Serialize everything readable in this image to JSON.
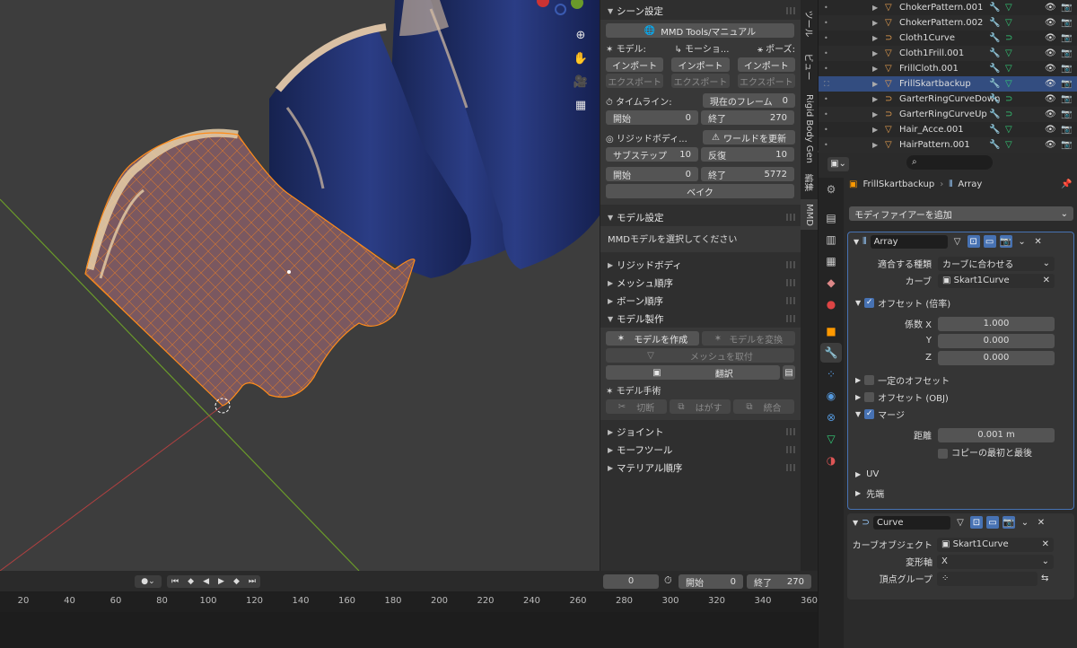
{
  "viewport": {
    "nav": {
      "zoom": "zoom-icon",
      "hand": "hand-icon",
      "camera": "camera-icon",
      "grid": "grid-icon"
    }
  },
  "npanel": {
    "scene": {
      "title": "シーン設定",
      "manual_button": "MMD Tools/マニュアル",
      "model_label": "モデル:",
      "motion_label": "モーショ...",
      "pose_label": "ポーズ:",
      "import": "インポート",
      "export": "エクスポート",
      "timeline_label": "タイムライン:",
      "current_frame_label": "現在のフレーム",
      "current_frame": "0",
      "start_label": "開始",
      "start": "0",
      "end_label": "終了",
      "end": "270",
      "rigidbody_label": "リジッドボディ...",
      "update_world": "ワールドを更新",
      "substep_label": "サブステップ",
      "substep": "10",
      "iter_label": "反復",
      "iter": "10",
      "rb_start": "0",
      "rb_end": "5772",
      "bake": "ベイク"
    },
    "model": {
      "title": "モデル設定",
      "hint": "MMDモデルを選択してください"
    },
    "sections": [
      "リジッドボディ",
      "メッシュ順序",
      "ボーン順序"
    ],
    "model_make": {
      "title": "モデル製作",
      "create": "モデルを作成",
      "convert": "モデルを変換",
      "attach": "メッシュを取付",
      "translate": "翻訳",
      "surgery": "モデル手術",
      "cut": "切断",
      "separate": "はがす",
      "merge": "統合"
    },
    "sections2": [
      "ジョイント",
      "モーフツール",
      "マテリアル順序"
    ]
  },
  "vtabs": [
    "ツール",
    "ビュー",
    "Rigid Body Gen",
    "編集",
    "MMD"
  ],
  "timeline": {
    "frame": "0",
    "start_label": "開始",
    "start": "0",
    "end_label": "終了",
    "end": "270",
    "ticks": [
      "20",
      "40",
      "60",
      "80",
      "100",
      "120",
      "140",
      "160",
      "180",
      "200",
      "220",
      "240",
      "260",
      "280",
      "300",
      "320",
      "340",
      "360"
    ]
  },
  "outliner": {
    "items": [
      {
        "name": "ChokerPattern.001",
        "type": "mesh"
      },
      {
        "name": "ChokerPattern.002",
        "type": "mesh"
      },
      {
        "name": "Cloth1Curve",
        "type": "curve"
      },
      {
        "name": "Cloth1Frill.001",
        "type": "mesh"
      },
      {
        "name": "FrillCloth.001",
        "type": "mesh"
      },
      {
        "name": "FrillSkartbackup",
        "type": "mesh",
        "selected": true
      },
      {
        "name": "GarterRingCurveDown",
        "type": "curve"
      },
      {
        "name": "GarterRingCurveUp",
        "type": "curve"
      },
      {
        "name": "Hair_Acce.001",
        "type": "mesh"
      },
      {
        "name": "HairPattern.001",
        "type": "mesh"
      }
    ]
  },
  "props": {
    "search_placeholder": "",
    "object": "FrillSkartbackup",
    "modifier_name": "Array",
    "add_modifier": "モディファイアーを追加",
    "array": {
      "name": "Array",
      "fit_type_label": "適合する種類",
      "fit_type": "カーブに合わせる",
      "curve_label": "カーブ",
      "curve": "Skart1Curve",
      "relative_offset": "オフセット (倍率)",
      "factor_x_label": "係数 X",
      "factor_x": "1.000",
      "y_label": "Y",
      "y": "0.000",
      "z_label": "Z",
      "z": "0.000",
      "constant_offset": "一定のオフセット",
      "object_offset": "オフセット (OBJ)",
      "merge": "マージ",
      "distance_label": "距離",
      "distance": "0.001 m",
      "first_last": "コピーの最初と最後",
      "uv": "UV",
      "caps": "先端"
    },
    "curve_mod": {
      "name": "Curve",
      "curve_object_label": "カーブオブジェクト",
      "curve_object": "Skart1Curve",
      "deform_axis_label": "変形軸",
      "deform_axis": "X",
      "vertex_group_label": "頂点グループ",
      "vertex_group": ""
    }
  },
  "colors": {
    "accent": "#4772b3",
    "selection": "#ff8c1a",
    "cloth": "#1c2a62"
  }
}
